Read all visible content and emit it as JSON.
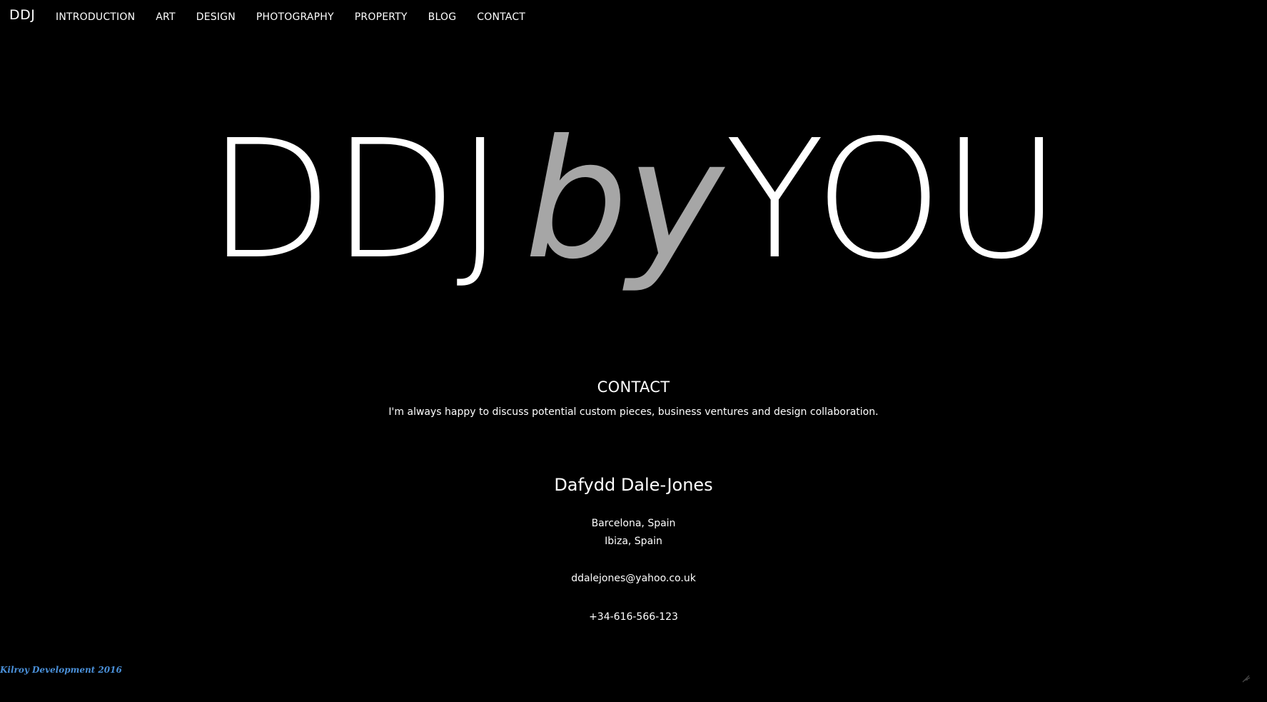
{
  "nav": {
    "brand": "DDJ",
    "links": [
      "INTRODUCTION",
      "ART",
      "DESIGN",
      "PHOTOGRAPHY",
      "PROPERTY",
      "BLOG",
      "CONTACT"
    ]
  },
  "hero": {
    "part1": "DDJ",
    "part2": "by",
    "part3": "YOU",
    "colors": {
      "primary": "#ffffff",
      "accent": "#a6a6a6"
    }
  },
  "contact": {
    "heading": "CONTACT",
    "blurb": "I'm always happy to discuss potential custom pieces, business ventures and design collaboration.",
    "name": "Dafydd Dale-Jones",
    "locations": [
      "Barcelona, Spain",
      "Ibiza, Spain"
    ],
    "email": "ddalejones@yahoo.co.uk",
    "phone": "+34-616-566-123"
  },
  "footer": {
    "credit": "Kilroy Development 2016",
    "credit_color": "#4a90d9",
    "corner_icon": "feather-icon"
  }
}
